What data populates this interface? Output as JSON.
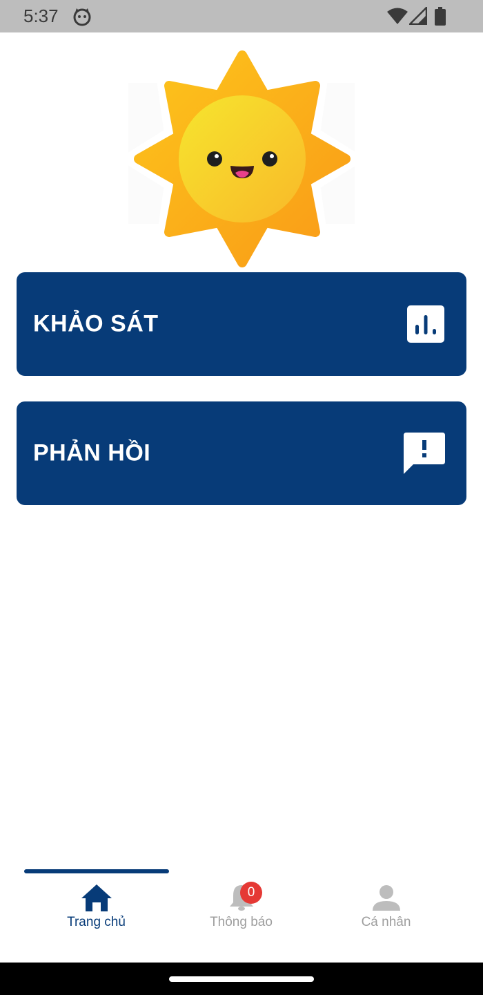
{
  "status_bar": {
    "time": "5:37",
    "icons": [
      "cat-face-icon",
      "wifi-icon",
      "signal-icon",
      "battery-icon"
    ]
  },
  "logo": {
    "name": "smiling-sun"
  },
  "menu": {
    "survey_label": "KHẢO SÁT",
    "survey_icon": "bar-chart-icon",
    "feedback_label": "PHẢN HỒI",
    "feedback_icon": "feedback-chat-icon"
  },
  "bottom_nav": {
    "items": [
      {
        "label": "Trang chủ",
        "icon": "home-icon",
        "active": true
      },
      {
        "label": "Thông báo",
        "icon": "bell-icon",
        "active": false
      },
      {
        "label": "Cá nhân",
        "icon": "person-icon",
        "active": false
      }
    ],
    "notification_badge": "0"
  },
  "colors": {
    "primary": "#073b78",
    "inactive": "#9e9e9e",
    "badge": "#e53935",
    "status_bar": "#bdbdbd"
  }
}
